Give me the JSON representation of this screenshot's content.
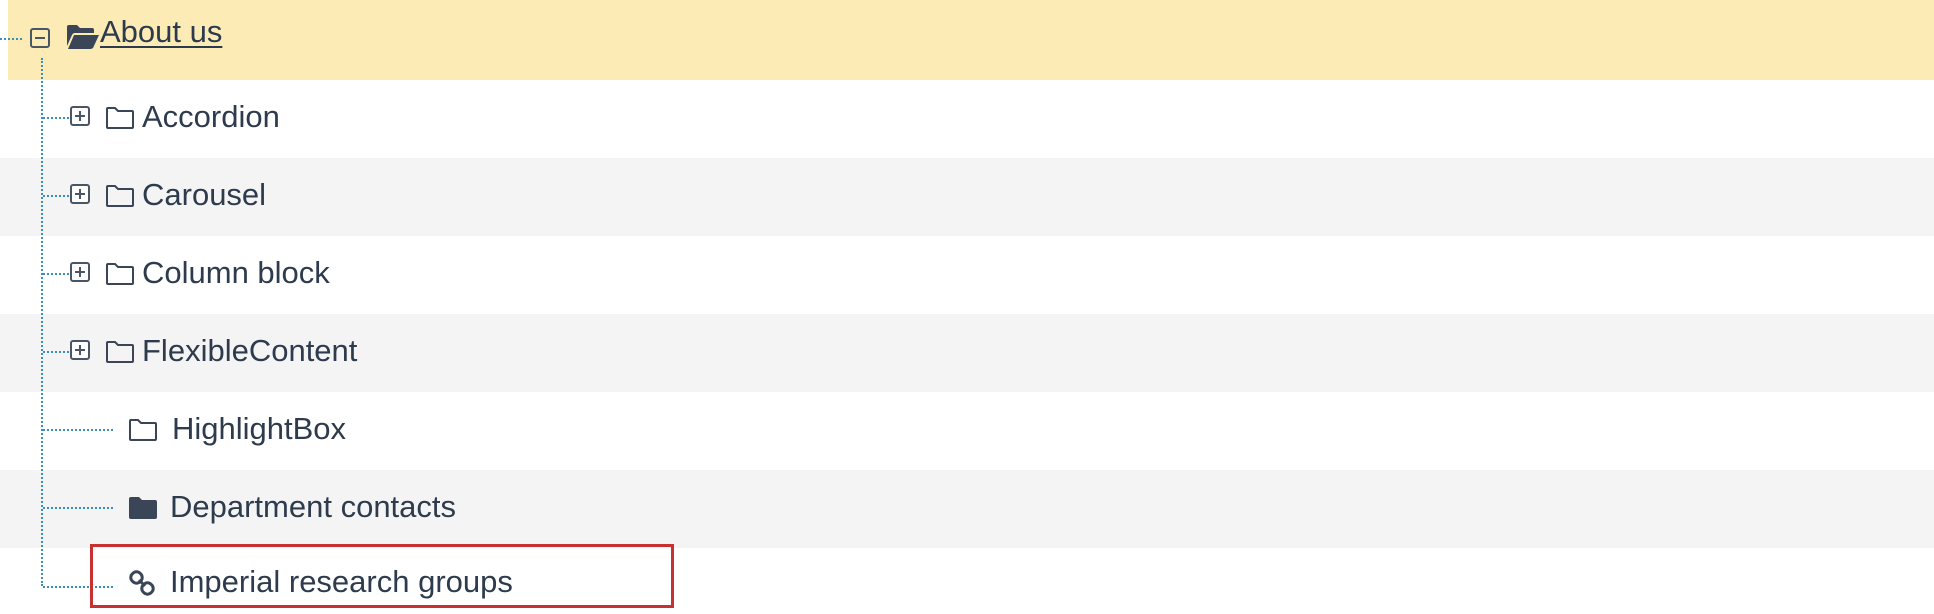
{
  "tree": {
    "root": {
      "label": "About us",
      "expanded": true,
      "icon": "folder-open-icon"
    },
    "children": [
      {
        "label": "Accordion",
        "expandable": true,
        "icon": "folder-outline-icon"
      },
      {
        "label": "Carousel",
        "expandable": true,
        "icon": "folder-outline-icon"
      },
      {
        "label": "Column block",
        "expandable": true,
        "icon": "folder-outline-icon"
      },
      {
        "label": "FlexibleContent",
        "expandable": true,
        "icon": "folder-outline-icon"
      },
      {
        "label": "HighlightBox",
        "expandable": false,
        "icon": "folder-outline-icon"
      },
      {
        "label": "Department contacts",
        "expandable": false,
        "icon": "folder-filled-icon"
      },
      {
        "label": "Imperial research groups",
        "expandable": false,
        "icon": "link-icon",
        "highlighted": true
      }
    ]
  },
  "colors": {
    "selected_row": "#fcebb5",
    "alt_row": "#f4f4f5",
    "connector": "#3a8fbf",
    "highlight_border": "#c8312f",
    "text": "#2d3b4d"
  }
}
